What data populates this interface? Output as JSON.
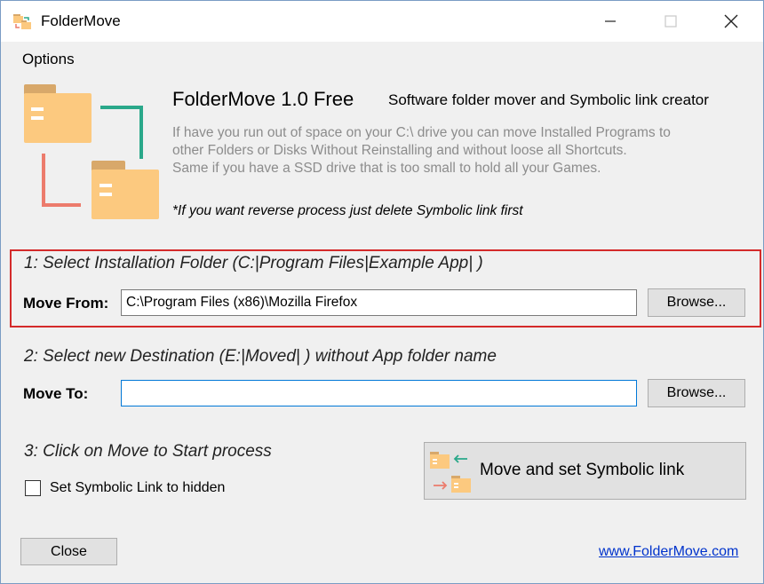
{
  "window": {
    "title": "FolderMove",
    "icon": "folder-app-icon",
    "controls": [
      "minimize",
      "maximize",
      "close"
    ]
  },
  "menu": {
    "options_label": "Options"
  },
  "header": {
    "app_name": "FolderMove 1.0 Free",
    "tagline": "Software folder mover and Symbolic link creator",
    "description": [
      "If have you run out of space on your C:\\ drive you can move Installed Programs to",
      "other Folders or Disks Without Reinstalling and without loose all Shortcuts.",
      "Same if you have a SSD drive that is too small to hold all your Games."
    ],
    "note": "*If you want reverse process just delete Symbolic link first"
  },
  "step1": {
    "label": "1: Select Installation Folder (C:|Program Files|Example App| )",
    "field_label": "Move From:",
    "value": "C:\\Program Files (x86)\\Mozilla Firefox",
    "browse_label": "Browse..."
  },
  "step2": {
    "label": "2: Select new Destination (E:|Moved| ) without App folder name",
    "field_label": "Move To:",
    "value": "",
    "browse_label": "Browse..."
  },
  "step3": {
    "label": "3: Click on Move to Start process",
    "move_button_label": "Move and set Symbolic link",
    "hidden_checkbox_label": "Set Symbolic Link to hidden",
    "hidden_checked": false
  },
  "footer": {
    "close_label": "Close",
    "link_text": "www.FolderMove.com"
  },
  "colors": {
    "folder_body": "#fcc97f",
    "folder_tab": "#d8a86a",
    "arrow_green": "#2aa88a",
    "arrow_red": "#ec7b6c",
    "highlight_border": "#d42a2a",
    "link": "#0033cc"
  }
}
